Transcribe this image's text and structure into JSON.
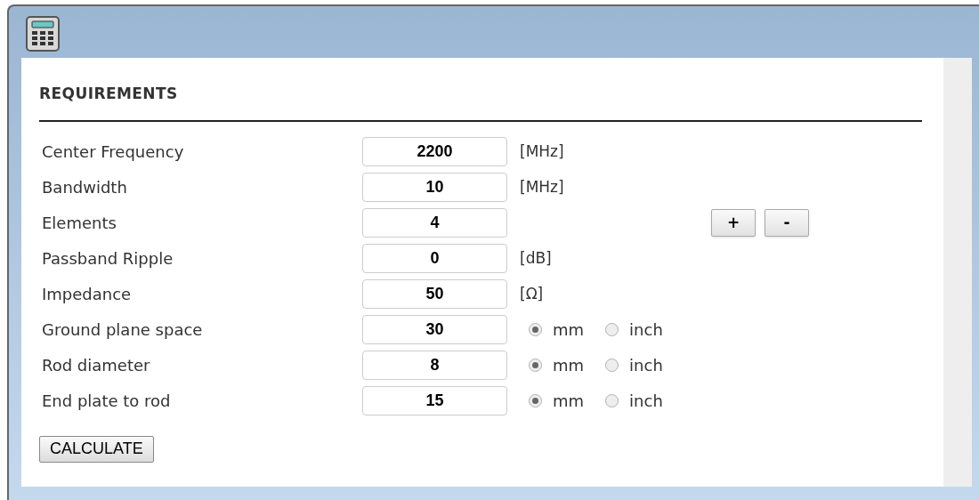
{
  "section_title": "REQUIREMENTS",
  "rows": [
    {
      "kind": "unit",
      "label": "Center Frequency",
      "value": "2200",
      "unit": "[MHz]"
    },
    {
      "kind": "unit",
      "label": "Bandwidth",
      "value": "10",
      "unit": "[MHz]"
    },
    {
      "kind": "stepper",
      "label": "Elements",
      "value": "4",
      "buttons": [
        "+",
        "-"
      ]
    },
    {
      "kind": "unit",
      "label": "Passband Ripple",
      "value": "0",
      "unit": "[dB]"
    },
    {
      "kind": "unit",
      "label": "Impedance",
      "value": "50",
      "unit": "[Ω]"
    },
    {
      "kind": "radio",
      "label": "Ground plane space",
      "value": "30",
      "options": [
        {
          "label": "mm",
          "selected": true
        },
        {
          "label": "inch",
          "selected": false
        }
      ]
    },
    {
      "kind": "radio",
      "label": "Rod diameter",
      "value": "8",
      "options": [
        {
          "label": "mm",
          "selected": true
        },
        {
          "label": "inch",
          "selected": false
        }
      ]
    },
    {
      "kind": "radio",
      "label": "End plate to rod",
      "value": "15",
      "options": [
        {
          "label": "mm",
          "selected": true
        },
        {
          "label": "inch",
          "selected": false
        }
      ]
    }
  ],
  "calculate_button": "CALCULATE"
}
